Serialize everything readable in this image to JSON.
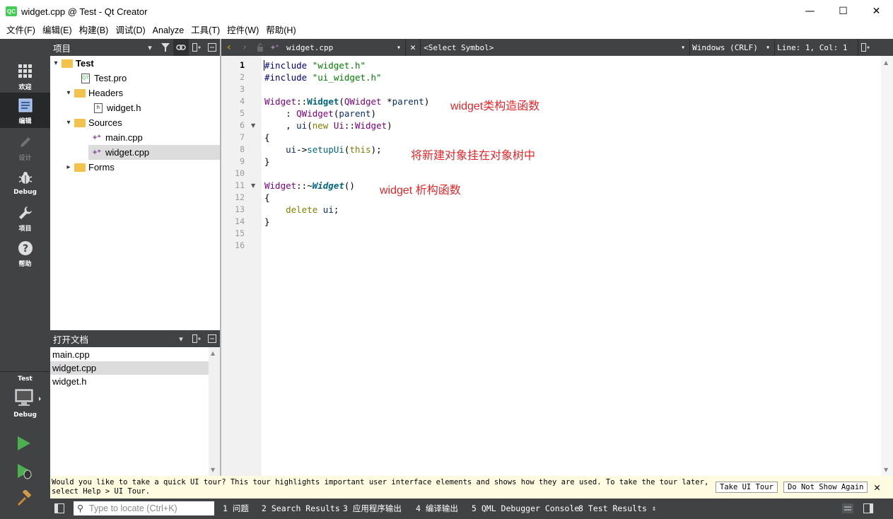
{
  "window": {
    "title": "widget.cpp @ Test - Qt Creator",
    "logo_text": "QC",
    "min": "—",
    "max": "☐",
    "close": "✕"
  },
  "menu": [
    {
      "label": "文件(F)"
    },
    {
      "label": "编辑(E)"
    },
    {
      "label": "构建(B)"
    },
    {
      "label": "调试(D)"
    },
    {
      "label": "Analyze"
    },
    {
      "label": "工具(T)"
    },
    {
      "label": "控件(W)"
    },
    {
      "label": "帮助(H)"
    }
  ],
  "modes": [
    {
      "label": "欢迎"
    },
    {
      "label": "编辑"
    },
    {
      "label": "设计"
    },
    {
      "label": "Debug"
    },
    {
      "label": "项目"
    },
    {
      "label": "帮助"
    }
  ],
  "target": {
    "project": "Test",
    "config": "Debug"
  },
  "project_pane": {
    "title": "项目",
    "tree": [
      {
        "label": "Test"
      },
      {
        "label": "Test.pro"
      },
      {
        "label": "Headers"
      },
      {
        "label": "widget.h"
      },
      {
        "label": "Sources"
      },
      {
        "label": "main.cpp"
      },
      {
        "label": "widget.cpp"
      },
      {
        "label": "Forms"
      }
    ]
  },
  "open_docs": {
    "title": "打开文档",
    "items": [
      {
        "label": "main.cpp"
      },
      {
        "label": "widget.cpp"
      },
      {
        "label": "widget.h"
      }
    ]
  },
  "editor_toolbar": {
    "file": "widget.cpp",
    "symbol": "<Select Symbol>",
    "line_ending": "Windows (CRLF)",
    "position": "Line: 1, Col: 1"
  },
  "editor": {
    "line_numbers": [
      "1",
      "2",
      "3",
      "4",
      "5",
      "6",
      "7",
      "8",
      "9",
      "10",
      "11",
      "12",
      "13",
      "14",
      "15",
      "16"
    ],
    "annotations": {
      "ctor": "widget类构造函数",
      "setup": "将新建对象挂在对象树中",
      "dtor": "widget 析构函数"
    }
  },
  "infobar": {
    "text": "Would you like to take a quick UI tour? This tour highlights important user interface elements and shows how they are used. To take the tour later, select Help > UI Tour.",
    "take_tour": "Take UI Tour",
    "dont_show": "Do Not Show Again"
  },
  "statusbar": {
    "locator_placeholder": "Type to locate (Ctrl+K)",
    "tabs": [
      {
        "label": "1  问题"
      },
      {
        "label": "2  Search Results"
      },
      {
        "label": "3  应用程序输出"
      },
      {
        "label": "4  编译输出"
      },
      {
        "label": "5  QML Debugger Console"
      },
      {
        "label": "8  Test Results"
      }
    ]
  }
}
